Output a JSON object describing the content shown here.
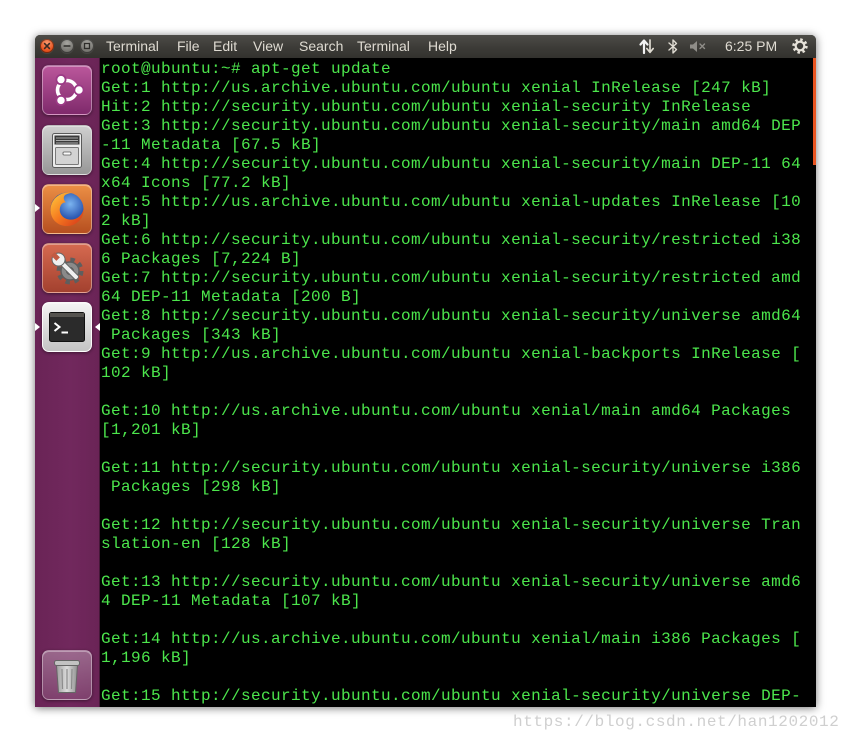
{
  "topbar": {
    "window_controls": [
      {
        "icon": "close-icon"
      },
      {
        "icon": "minimize-icon"
      },
      {
        "icon": "maximize-icon"
      }
    ],
    "app_title": "Terminal",
    "menu": [
      "File",
      "Edit",
      "View",
      "Search",
      "Terminal",
      "Help"
    ],
    "indicators": {
      "network_icon": "network-updown-icon",
      "bluetooth_icon": "bluetooth-icon",
      "volume_icon": "volume-muted-icon",
      "clock": "6:25 PM",
      "session_icon": "gear-icon"
    }
  },
  "launcher": {
    "items": [
      {
        "icon": "ubuntu-dash-icon",
        "running": false,
        "focused": false
      },
      {
        "icon": "files-icon",
        "running": false,
        "focused": false
      },
      {
        "icon": "firefox-icon",
        "running": true,
        "focused": false
      },
      {
        "icon": "system-settings-icon",
        "running": false,
        "focused": false
      },
      {
        "icon": "terminal-icon",
        "running": true,
        "focused": true
      },
      {
        "icon": "trash-icon",
        "running": false,
        "focused": false
      }
    ]
  },
  "terminal": {
    "lines": [
      "root@ubuntu:~# apt-get update",
      "Get:1 http://us.archive.ubuntu.com/ubuntu xenial InRelease [247 kB]",
      "Hit:2 http://security.ubuntu.com/ubuntu xenial-security InRelease",
      "Get:3 http://security.ubuntu.com/ubuntu xenial-security/main amd64 DEP",
      "-11 Metadata [67.5 kB]",
      "Get:4 http://security.ubuntu.com/ubuntu xenial-security/main DEP-11 64",
      "x64 Icons [77.2 kB]",
      "Get:5 http://us.archive.ubuntu.com/ubuntu xenial-updates InRelease [10",
      "2 kB]",
      "Get:6 http://security.ubuntu.com/ubuntu xenial-security/restricted i38",
      "6 Packages [7,224 B]",
      "Get:7 http://security.ubuntu.com/ubuntu xenial-security/restricted amd",
      "64 DEP-11 Metadata [200 B]",
      "Get:8 http://security.ubuntu.com/ubuntu xenial-security/universe amd64",
      " Packages [343 kB]",
      "Get:9 http://us.archive.ubuntu.com/ubuntu xenial-backports InRelease [",
      "102 kB]",
      "",
      "Get:10 http://us.archive.ubuntu.com/ubuntu xenial/main amd64 Packages",
      "[1,201 kB]",
      "",
      "Get:11 http://security.ubuntu.com/ubuntu xenial-security/universe i386",
      " Packages [298 kB]",
      "",
      "Get:12 http://security.ubuntu.com/ubuntu xenial-security/universe Tran",
      "slation-en [128 kB]",
      "",
      "Get:13 http://security.ubuntu.com/ubuntu xenial-security/universe amd6",
      "4 DEP-11 Metadata [107 kB]",
      "",
      "Get:14 http://us.archive.ubuntu.com/ubuntu xenial/main i386 Packages [",
      "1,196 kB]",
      "",
      "Get:15 http://security.ubuntu.com/ubuntu xenial-security/universe DEP-"
    ]
  },
  "watermark": "https://blog.csdn.net/han1202012",
  "colors": {
    "terminal_text": "#4ce64c",
    "terminal_bg": "#000000",
    "topbar_bg": "#3c3b37",
    "topbar_text": "#dfdbd2",
    "launcher_bg": "#71285d",
    "scrollbar": "#e95420",
    "close_button": "#e9541f",
    "watermark": "#cfcfcf"
  }
}
